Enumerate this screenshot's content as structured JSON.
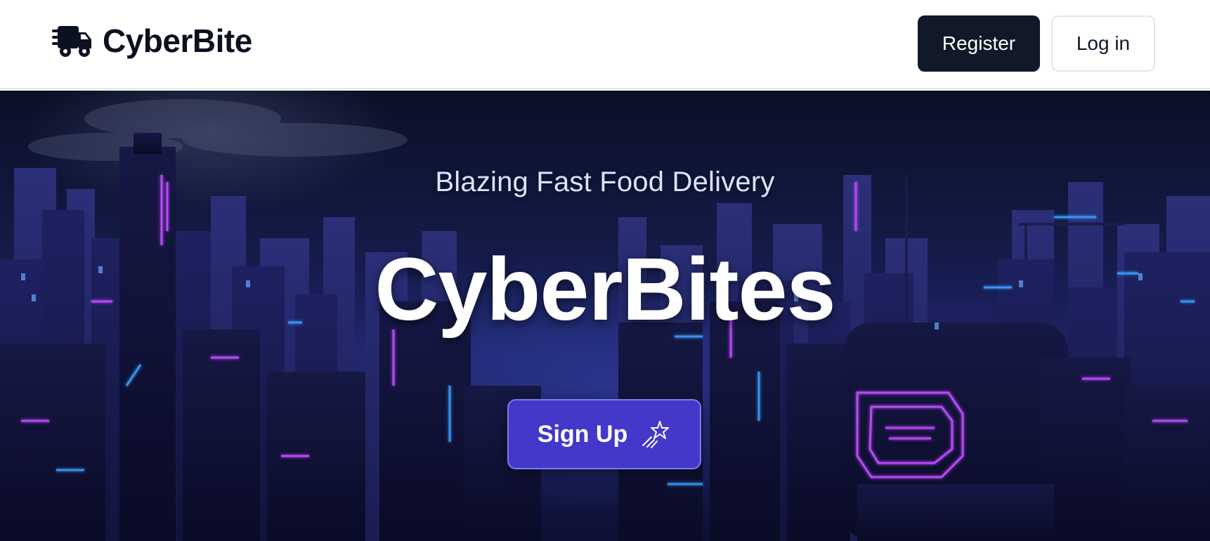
{
  "header": {
    "brand_name": "CyberBite",
    "brand_icon": "truck-fast-icon",
    "register_label": "Register",
    "login_label": "Log in"
  },
  "hero": {
    "tagline": "Blazing Fast Food Delivery",
    "title": "CyberBites",
    "signup_label": "Sign Up",
    "signup_icon": "shooting-star-icon",
    "background": "neon-cyberpunk-city-illustration"
  },
  "colors": {
    "brand_text": "#0b1120",
    "register_bg": "#111827",
    "signup_bg": "#4338ca",
    "neon_purple": "#c04cff",
    "neon_blue": "#3aa0ff"
  }
}
